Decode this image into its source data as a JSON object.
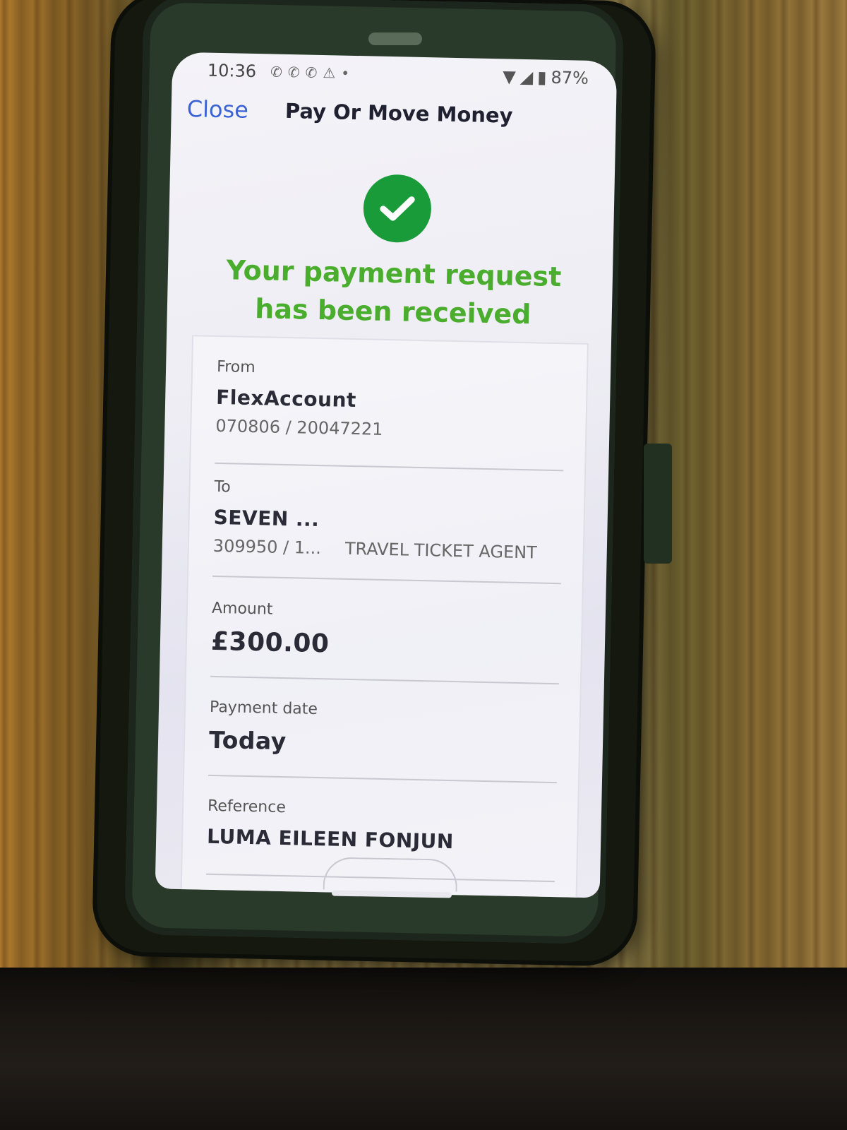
{
  "status_bar": {
    "time": "10:36",
    "notification_icons": [
      "whatsapp-icon",
      "whatsapp-icon",
      "whatsapp-icon",
      "alert-icon"
    ],
    "battery": "87%"
  },
  "nav": {
    "close_label": "Close",
    "title": "Pay Or Move Money"
  },
  "confirmation": {
    "icon": "check-circle-icon",
    "message_line1": "Your payment request",
    "message_line2": "has been received",
    "accent_color": "#1a9b3a"
  },
  "details": {
    "from": {
      "label": "From",
      "account_name": "FlexAccount",
      "account_number": "070806 / 20047221"
    },
    "to": {
      "label": "To",
      "payee_name": "SEVEN ...",
      "payee_number": "309950 / 1...",
      "payee_description": "TRAVEL TICKET AGENT"
    },
    "amount": {
      "label": "Amount",
      "value": "£300.00"
    },
    "payment_date": {
      "label": "Payment date",
      "value": "Today"
    },
    "reference": {
      "label": "Reference",
      "value": "LUMA EILEEN FONJUN"
    }
  }
}
